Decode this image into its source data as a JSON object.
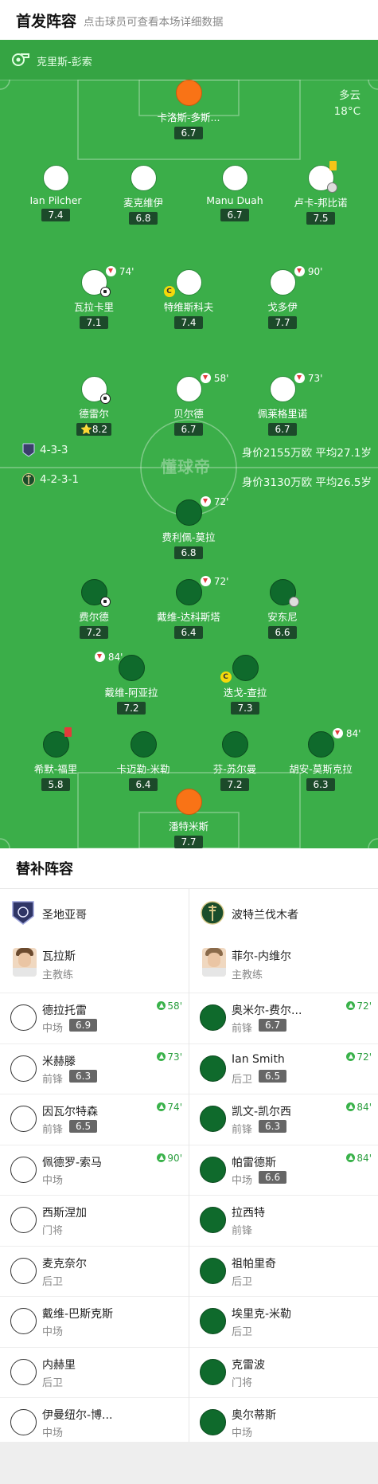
{
  "header": {
    "title": "首发阵容",
    "hint": "点击球员可查看本场详细数据"
  },
  "referee": {
    "name": "克里斯-彭索",
    "icon": "whistle-icon"
  },
  "weather": {
    "condition": "多云",
    "temp": "18°C"
  },
  "watermark": "懂球帝",
  "home_team": {
    "formation": "4-3-3",
    "value": "身价2155万欧 平均27.1岁"
  },
  "away_team": {
    "formation": "4-2-3-1",
    "value": "身价3130万欧 平均26.5岁"
  },
  "pitch_players": [
    {
      "name": "卡洛斯-多斯...",
      "rating": "6.7"
    },
    {
      "name": "Ian Pilcher",
      "rating": "7.4"
    },
    {
      "name": "麦克维伊",
      "rating": "6.8"
    },
    {
      "name": "Manu Duah",
      "rating": "6.7"
    },
    {
      "name": "卢卡-邦比诺",
      "rating": "7.5"
    },
    {
      "name": "瓦拉卡里",
      "rating": "7.1",
      "event": "74'"
    },
    {
      "name": "特维斯科夫",
      "rating": "7.4"
    },
    {
      "name": "戈多伊",
      "rating": "7.7",
      "event": "90'"
    },
    {
      "name": "德雷尔",
      "rating": "8.2"
    },
    {
      "name": "贝尔德",
      "rating": "6.7",
      "event": "58'"
    },
    {
      "name": "佩莱格里诺",
      "rating": "6.7",
      "event": "73'"
    },
    {
      "name": "费利佩-莫拉",
      "rating": "6.8",
      "event": "72'"
    },
    {
      "name": "费尔德",
      "rating": "7.2"
    },
    {
      "name": "戴维-达科斯塔",
      "rating": "6.4",
      "event": "72'"
    },
    {
      "name": "安东尼",
      "rating": "6.6"
    },
    {
      "name": "戴维-阿亚拉",
      "rating": "7.2",
      "event": "84'"
    },
    {
      "name": "迭戈-查拉",
      "rating": "7.3"
    },
    {
      "name": "希默-福里",
      "rating": "5.8"
    },
    {
      "name": "卡迈勒-米勒",
      "rating": "6.4"
    },
    {
      "name": "芬-苏尔曼",
      "rating": "7.2"
    },
    {
      "name": "胡安-莫斯克拉",
      "rating": "6.3",
      "event": "84'"
    },
    {
      "name": "潘特米斯",
      "rating": "7.7"
    }
  ],
  "subs": {
    "title": "替补阵容",
    "home": {
      "team": "圣地亚哥",
      "coach": {
        "name": "瓦拉斯",
        "role": "主教练"
      },
      "players": [
        {
          "name": "德拉托雷",
          "pos": "中场",
          "rating": "6.9",
          "minute": "58'"
        },
        {
          "name": "米赫滕",
          "pos": "前锋",
          "rating": "6.3",
          "minute": "73'"
        },
        {
          "name": "因瓦尔特森",
          "pos": "前锋",
          "rating": "6.5",
          "minute": "74'"
        },
        {
          "name": "佩德罗-索马",
          "pos": "中场",
          "rating": "",
          "minute": "90'"
        },
        {
          "name": "西斯涅加",
          "pos": "门将",
          "rating": "",
          "minute": ""
        },
        {
          "name": "麦克奈尔",
          "pos": "后卫",
          "rating": "",
          "minute": ""
        },
        {
          "name": "戴维-巴斯克斯",
          "pos": "中场",
          "rating": "",
          "minute": ""
        },
        {
          "name": "内赫里",
          "pos": "后卫",
          "rating": "",
          "minute": ""
        },
        {
          "name": "伊曼纽尔-博...",
          "pos": "中场",
          "rating": "",
          "minute": ""
        }
      ]
    },
    "away": {
      "team": "波特兰伐木者",
      "coach": {
        "name": "菲尔-内维尔",
        "role": "主教练"
      },
      "players": [
        {
          "name": "奥米尔-费尔...",
          "pos": "前锋",
          "rating": "6.7",
          "minute": "72'"
        },
        {
          "name": "Ian Smith",
          "pos": "后卫",
          "rating": "6.5",
          "minute": "72'"
        },
        {
          "name": "凯文-凯尔西",
          "pos": "前锋",
          "rating": "6.3",
          "minute": "84'"
        },
        {
          "name": "帕雷德斯",
          "pos": "中场",
          "rating": "6.6",
          "minute": "84'"
        },
        {
          "name": "拉西特",
          "pos": "前锋",
          "rating": "",
          "minute": ""
        },
        {
          "name": "祖帕里奇",
          "pos": "后卫",
          "rating": "",
          "minute": ""
        },
        {
          "name": "埃里克-米勒",
          "pos": "后卫",
          "rating": "",
          "minute": ""
        },
        {
          "name": "克雷波",
          "pos": "门将",
          "rating": "",
          "minute": ""
        },
        {
          "name": "奥尔蒂斯",
          "pos": "中场",
          "rating": "",
          "minute": ""
        }
      ]
    }
  }
}
